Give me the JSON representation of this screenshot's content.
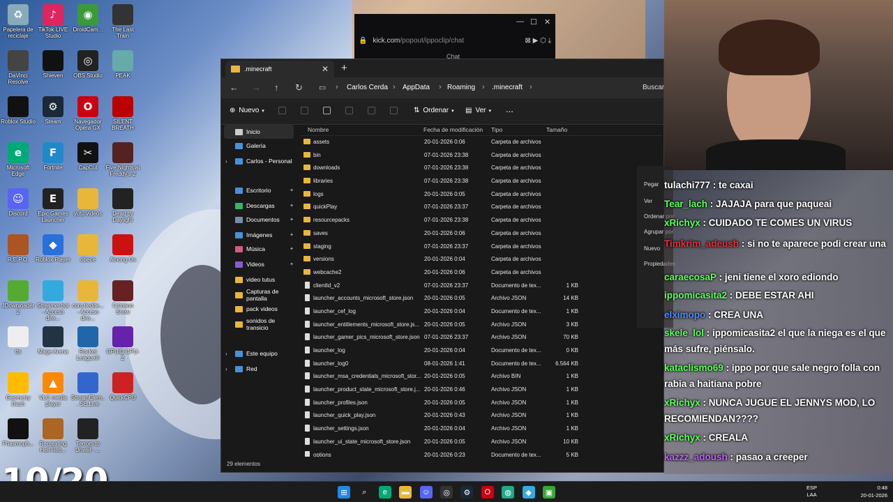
{
  "colors": {
    "folder": "#e8b73a",
    "accent": "#4a90d9",
    "chat_bg": "#2a2525"
  },
  "desktop": {
    "icons": [
      {
        "label": "Papelera de reciclaje",
        "icon": "recycle-bin-icon",
        "color": "#8ab"
      },
      {
        "label": "TikTok LIVE Studio",
        "icon": "tiktok-icon",
        "color": "#e0245e"
      },
      {
        "label": "DroidCam...",
        "icon": "droidcam-icon",
        "color": "#3a9a3a"
      },
      {
        "label": "The Last Train",
        "icon": "game-icon",
        "color": "#333"
      },
      {
        "label": "DaVinci Resolve",
        "icon": "davinci-icon",
        "color": "#444"
      },
      {
        "label": "Shieven",
        "icon": "shieven-icon",
        "color": "#111"
      },
      {
        "label": "OBS Studio",
        "icon": "obs-icon",
        "color": "#222"
      },
      {
        "label": "PEAK",
        "icon": "peak-icon",
        "color": "#6aa"
      },
      {
        "label": "Roblox Studio",
        "icon": "roblox-studio-icon",
        "color": "#111"
      },
      {
        "label": "Steam",
        "icon": "steam-icon",
        "color": "#1b2838"
      },
      {
        "label": "Navegador Opera GX",
        "icon": "opera-icon",
        "color": "#c01"
      },
      {
        "label": "SILENT BREATH",
        "icon": "game-icon",
        "color": "#b00"
      },
      {
        "label": "Microsoft Edge",
        "icon": "edge-icon",
        "color": "#0a7"
      },
      {
        "label": "Fortnite",
        "icon": "fortnite-icon",
        "color": "#28c"
      },
      {
        "label": "CapCut",
        "icon": "capcut-icon",
        "color": "#111"
      },
      {
        "label": "Five Nights at Freddy's 2",
        "icon": "fnaf-icon",
        "color": "#522"
      },
      {
        "label": "Discord",
        "icon": "discord-icon",
        "color": "#5865f2"
      },
      {
        "label": "Epic Games Launcher",
        "icon": "epic-icon",
        "color": "#222"
      },
      {
        "label": "yutu videos",
        "icon": "folder-icon",
        "color": "#e8b73a"
      },
      {
        "label": "Dead by Daylight",
        "icon": "dbd-icon",
        "color": "#222"
      },
      {
        "label": "R.E.P.O.",
        "icon": "repo-icon",
        "color": "#a52"
      },
      {
        "label": "Roblox Player",
        "icon": "roblox-icon",
        "color": "#2a6fdb"
      },
      {
        "label": "obece",
        "icon": "folder-icon",
        "color": "#e8b73a"
      },
      {
        "label": "Among Us",
        "icon": "amongus-icon",
        "color": "#c11"
      },
      {
        "label": "JDownloader 2",
        "icon": "jdownloader-icon",
        "color": "#5a3"
      },
      {
        "label": "Streamer.bot - Acceso dire...",
        "icon": "streamerbot-icon",
        "color": "#3ad"
      },
      {
        "label": "com.ltedite... - Acceso dire...",
        "icon": "folder-icon",
        "color": "#e8b73a"
      },
      {
        "label": "Crimson Snow",
        "icon": "game-icon",
        "color": "#622"
      },
      {
        "label": "tts",
        "icon": "file-icon",
        "color": "#eee"
      },
      {
        "label": "Mage Arena",
        "icon": "game-icon",
        "color": "#234"
      },
      {
        "label": "Rocket League®",
        "icon": "rocket-league-icon",
        "color": "#26a"
      },
      {
        "label": "GPUID CPU-Z",
        "icon": "cpuz-icon",
        "color": "#62a"
      },
      {
        "label": "Geometry Dash",
        "icon": "geometry-dash-icon",
        "color": "#fb0"
      },
      {
        "label": "VLC media player",
        "icon": "vlc-icon",
        "color": "#f80"
      },
      {
        "label": "StreamElem... SE.Live",
        "icon": "streamelements-icon",
        "color": "#36c"
      },
      {
        "label": "QuickCPU",
        "icon": "quickcpu-icon",
        "color": "#c22"
      },
      {
        "label": "Phasmoph...",
        "icon": "phasmophobia-icon",
        "color": "#111"
      },
      {
        "label": "Recreating Hell Reb...",
        "icon": "game-icon",
        "color": "#a62"
      },
      {
        "label": "Terrors to Unveil - ...",
        "icon": "game-icon",
        "color": "#222"
      }
    ]
  },
  "counter": "10/20",
  "browser": {
    "url_host": "kick.com",
    "url_path": "/popout/ippoclip/chat",
    "chat_label": "Chat"
  },
  "explorer": {
    "tab_title": ".minecraft",
    "breadcrumb": [
      "Carlos Cerda",
      "AppData",
      "Roaming",
      ".minecraft"
    ],
    "search_placeholder": "Buscar",
    "commands": {
      "new": "Nuevo",
      "sort": "Ordenar",
      "view": "Ver",
      "more": "..."
    },
    "columns": {
      "name": "Nombre",
      "date": "Fecha de modificación",
      "type": "Tipo",
      "size": "Tamaño"
    },
    "sidebar": [
      {
        "label": "Inicio",
        "icon": "home-icon"
      },
      {
        "label": "Galería",
        "icon": "gallery-icon"
      },
      {
        "label": "Carlos - Personal",
        "icon": "cloud-icon"
      },
      {
        "label": "Escritorio",
        "icon": "desktop-icon"
      },
      {
        "label": "Descargas",
        "icon": "download-icon"
      },
      {
        "label": "Documentos",
        "icon": "documents-icon"
      },
      {
        "label": "Imágenes",
        "icon": "pictures-icon"
      },
      {
        "label": "Música",
        "icon": "music-icon"
      },
      {
        "label": "Videos",
        "icon": "videos-icon"
      },
      {
        "label": "video tutus",
        "icon": "folder-icon"
      },
      {
        "label": "Capturas de pantalla",
        "icon": "folder-icon"
      },
      {
        "label": "pack videos",
        "icon": "folder-icon"
      },
      {
        "label": "sonidos de transicio",
        "icon": "folder-icon"
      },
      {
        "label": "Este equipo",
        "icon": "pc-icon"
      },
      {
        "label": "Red",
        "icon": "network-icon"
      }
    ],
    "files": [
      {
        "name": "assets",
        "date": "20-01-2026 0:06",
        "type": "Carpeta de archivos",
        "size": "",
        "kind": "folder"
      },
      {
        "name": "bin",
        "date": "07-01-2026 23:38",
        "type": "Carpeta de archivos",
        "size": "",
        "kind": "folder"
      },
      {
        "name": "downloads",
        "date": "07-01-2026 23:38",
        "type": "Carpeta de archivos",
        "size": "",
        "kind": "folder"
      },
      {
        "name": "libraries",
        "date": "07-01-2026 23:38",
        "type": "Carpeta de archivos",
        "size": "",
        "kind": "folder"
      },
      {
        "name": "logs",
        "date": "20-01-2026 0:05",
        "type": "Carpeta de archivos",
        "size": "",
        "kind": "folder"
      },
      {
        "name": "quickPlay",
        "date": "07-01-2026 23:37",
        "type": "Carpeta de archivos",
        "size": "",
        "kind": "folder"
      },
      {
        "name": "resourcepacks",
        "date": "07-01-2026 23:38",
        "type": "Carpeta de archivos",
        "size": "",
        "kind": "folder"
      },
      {
        "name": "saves",
        "date": "20-01-2026 0:06",
        "type": "Carpeta de archivos",
        "size": "",
        "kind": "folder"
      },
      {
        "name": "staging",
        "date": "07-01-2026 23:37",
        "type": "Carpeta de archivos",
        "size": "",
        "kind": "folder"
      },
      {
        "name": "versions",
        "date": "20-01-2026 0:04",
        "type": "Carpeta de archivos",
        "size": "",
        "kind": "folder"
      },
      {
        "name": "webcache2",
        "date": "20-01-2026 0:06",
        "type": "Carpeta de archivos",
        "size": "",
        "kind": "folder"
      },
      {
        "name": "clientId_v2",
        "date": "07-01-2026 23:37",
        "type": "Documento de tex...",
        "size": "1 KB",
        "kind": "file"
      },
      {
        "name": "launcher_accounts_microsoft_store.json",
        "date": "20-01-2026 0:05",
        "type": "Archivo JSON",
        "size": "14 KB",
        "kind": "file"
      },
      {
        "name": "launcher_cef_log",
        "date": "20-01-2026 0:04",
        "type": "Documento de tex...",
        "size": "1 KB",
        "kind": "file"
      },
      {
        "name": "launcher_entitlements_microsoft_store.js...",
        "date": "20-01-2026 0:05",
        "type": "Archivo JSON",
        "size": "3 KB",
        "kind": "file"
      },
      {
        "name": "launcher_gamer_pics_microsoft_store.json",
        "date": "07-01-2026 23:37",
        "type": "Archivo JSON",
        "size": "70 KB",
        "kind": "file"
      },
      {
        "name": "launcher_log",
        "date": "20-01-2026 0:04",
        "type": "Documento de tex...",
        "size": "0 KB",
        "kind": "file"
      },
      {
        "name": "launcher_log0",
        "date": "08-01-2026 1:41",
        "type": "Documento de tex...",
        "size": "6.564 KB",
        "kind": "file"
      },
      {
        "name": "launcher_msa_credentials_microsoft_stor...",
        "date": "20-01-2026 0:05",
        "type": "Archivo BIN",
        "size": "1 KB",
        "kind": "file"
      },
      {
        "name": "launcher_product_state_microsoft_store.j...",
        "date": "20-01-2026 0:46",
        "type": "Archivo JSON",
        "size": "1 KB",
        "kind": "file"
      },
      {
        "name": "launcher_profiles.json",
        "date": "20-01-2026 0:05",
        "type": "Archivo JSON",
        "size": "1 KB",
        "kind": "file"
      },
      {
        "name": "launcher_quick_play.json",
        "date": "20-01-2026 0:43",
        "type": "Archivo JSON",
        "size": "1 KB",
        "kind": "file"
      },
      {
        "name": "launcher_settings.json",
        "date": "20-01-2026 0:04",
        "type": "Archivo JSON",
        "size": "1 KB",
        "kind": "file"
      },
      {
        "name": "launcher_ui_state_microsoft_store.json",
        "date": "20-01-2026 0:05",
        "type": "Archivo JSON",
        "size": "10 KB",
        "kind": "file"
      },
      {
        "name": "options",
        "date": "20-01-2026 0:23",
        "type": "Documento de tex...",
        "size": "5 KB",
        "kind": "file"
      }
    ],
    "status": "29 elementos"
  },
  "context_menu": [
    "Pegar",
    "Ver",
    "Ordenar por",
    "Agrupar por",
    "Nuevo",
    "Propiedades"
  ],
  "chat": [
    {
      "user": "tulachi777",
      "color": "#ffffff",
      "text": "te caxai"
    },
    {
      "user": "Tear_lach",
      "color": "#5dff5d",
      "text": "JAJAJA para que paqueai"
    },
    {
      "user": "xRichyx",
      "color": "#5dff5d",
      "text": "CUIDADO TE COMES UN VIRUS"
    },
    {
      "user": "Timkrim_adeush",
      "color": "#e0303a",
      "text": "si no te aparece podi crear una"
    },
    {
      "user": "caraecosaP",
      "color": "#5dff5d",
      "text": "jeni tiene el xoro ediondo"
    },
    {
      "user": "ippomicasita2",
      "color": "#5dff5d",
      "text": "DEBE ESTAR AHI"
    },
    {
      "user": "elximopo",
      "color": "#4a8cff",
      "text": "CREA UNA"
    },
    {
      "user": "skele_lol",
      "color": "#5dff5d",
      "text": "ippomicasita2 el que la niega es el que más sufre, piénsalo."
    },
    {
      "user": "kataclismo69",
      "color": "#5dff5d",
      "text": "ippo por que sale negro folla con rabia a haitiana pobre"
    },
    {
      "user": "xRichyx",
      "color": "#5dff5d",
      "text": "NUNCA JUGUE EL JENNYS MOD, LO RECOMIENDAN????"
    },
    {
      "user": "xRichyx",
      "color": "#5dff5d",
      "text": "CREALA"
    },
    {
      "user": "kazzz_adoush",
      "color": "#c05dff",
      "text": "pasao a creeper"
    }
  ],
  "taskbar": {
    "apps": [
      "start-icon",
      "search-icon",
      "edge-icon",
      "explorer-icon",
      "discord-icon",
      "obs-icon",
      "steam-icon",
      "opera-icon",
      "chrome-icon",
      "streamerbot-icon",
      "minecraft-icon"
    ],
    "lang_top": "ESP",
    "lang_bottom": "LAA",
    "time": "0:48",
    "date": "20-01-2026"
  }
}
